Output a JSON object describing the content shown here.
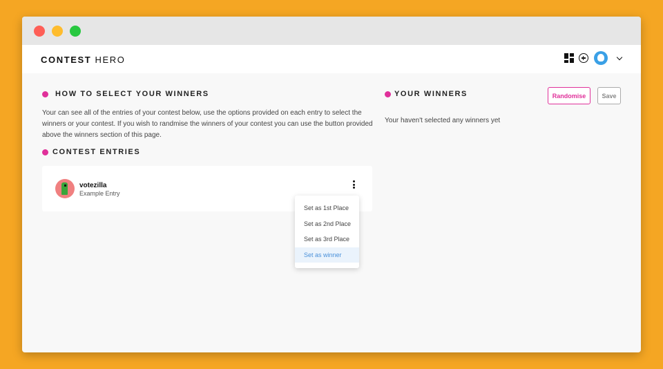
{
  "app": {
    "brand_bold": "CONTEST",
    "brand_light": "HERO"
  },
  "topbar": {
    "icons": [
      "dashboard-icon",
      "add-circle-icon",
      "user-avatar",
      "chevron-down-icon"
    ]
  },
  "left": {
    "select_heading": "HOW TO SELECT YOUR WINNERS",
    "description": "Your can see all of the entries of your contest below, use the options provided on each entry to select the winners or your contest. If you wish to randmise the winners of your contest you can use the button provided above the winners section of this page.",
    "entries_heading": "CONTEST ENTRIES",
    "entries": [
      {
        "name": "votezilla",
        "subtitle": "Example Entry"
      }
    ]
  },
  "menu": {
    "items": [
      "Set as 1st Place",
      "Set as 2nd Place",
      "Set as 3rd Place",
      "Set as winner"
    ],
    "active_index": 3
  },
  "right": {
    "heading": "YOUR WINNERS",
    "empty_text": "Your haven't selected any winners yet",
    "randomise_label": "Randomise",
    "save_label": "Save"
  },
  "colors": {
    "background": "#f5a623",
    "accent": "#e0309a",
    "menu_active": "#4a90d9"
  }
}
